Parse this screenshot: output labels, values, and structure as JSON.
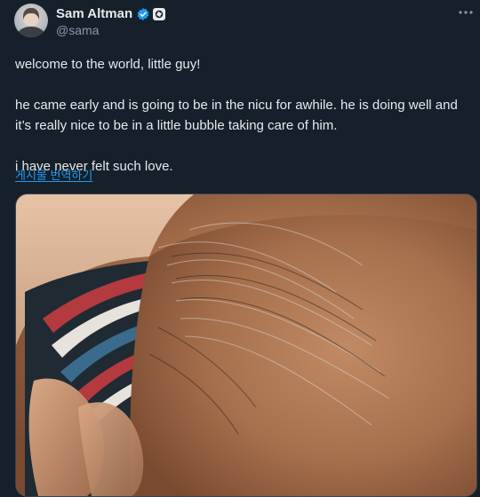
{
  "author": {
    "display_name": "Sam Altman",
    "handle": "@sama",
    "verified_icon": "verified-badge-icon",
    "affiliation_icon": "openai-logo-icon"
  },
  "tweet": {
    "paragraphs": [
      "welcome to the world, little guy!",
      "he came early and is going to be in the nicu for awhile. he is doing well and it’s really nice to be in a little bubble taking care of him.",
      "i have never felt such love."
    ],
    "translate_link": "게시물 번역하기"
  },
  "colors": {
    "background": "#15202b",
    "text": "#e7e9ea",
    "muted": "#8b98a5",
    "link": "#1d9bf0",
    "verified": "#1d9bf0"
  }
}
